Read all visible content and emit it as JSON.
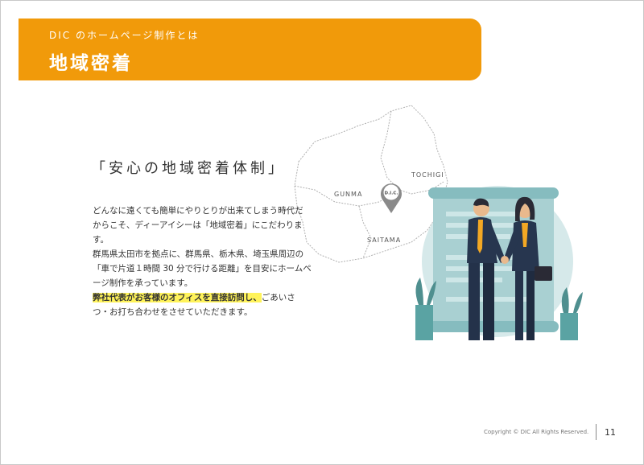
{
  "banner": {
    "subtitle": "DIC のホームページ制作とは",
    "title": "地域密着"
  },
  "heading": "「安心の地域密着体制」",
  "body": {
    "para1": "どんなに遠くても簡単にやりとりが出来てしまう時代だからこそ、ディーアイシーは「地域密着」にこだわります。",
    "para2": "群馬県太田市を拠点に、群馬県、栃木県、埼玉県周辺の「車で片道１時間 30 分で行ける距離」を目安にホームページ制作を承っています。",
    "highlight": "弊社代表がお客様のオフィスを直接訪問し、",
    "para3_rest": "ごあいさつ・お打ち合わせをさせていただきます。"
  },
  "map": {
    "labels": {
      "gunma": "GUNMA",
      "tochigi": "TOCHIGI",
      "saitama": "SAITAMA"
    },
    "pin_text": "D.I.C."
  },
  "footer": {
    "copyright": "Copyright © DIC All Rights Reserved.",
    "page_number": "11"
  },
  "colors": {
    "accent": "#f19a0a",
    "highlight": "#fff35a",
    "teal": "#7fb9b9",
    "navy": "#27364f"
  }
}
